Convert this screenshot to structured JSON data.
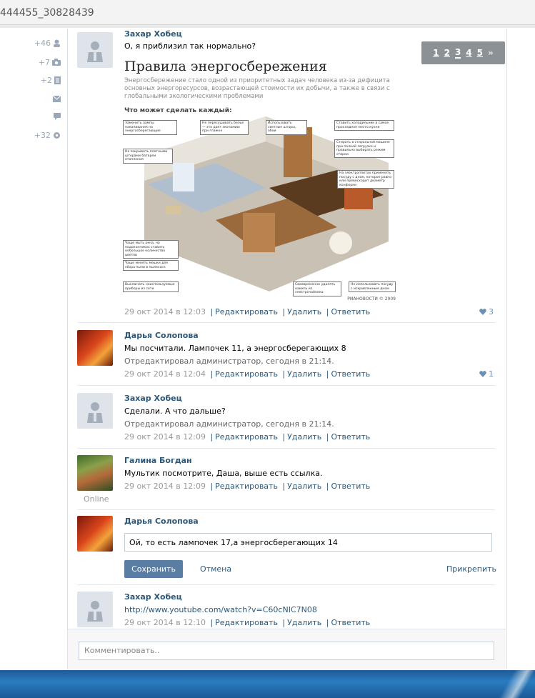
{
  "window": {
    "title": "444455_30828439"
  },
  "left_nav": [
    {
      "count": "+46",
      "icon": "user-icon"
    },
    {
      "count": "+7",
      "icon": "camera-icon"
    },
    {
      "count": "+2",
      "icon": "video-icon"
    },
    {
      "count": "",
      "icon": "mail-icon"
    },
    {
      "count": "",
      "icon": "chat-icon"
    },
    {
      "count": "+32",
      "icon": "gear-icon"
    }
  ],
  "pager": {
    "pages": [
      "1",
      "2",
      "3",
      "4",
      "5"
    ],
    "current": "3",
    "next": "»"
  },
  "infographic": {
    "title": "Правила энергосбережения",
    "subtitle": "Энергосбережение стало одной из приоритетных задач человека из-за дефицита основных энергоресурсов, возрастающей стоимости их добычи, а также в связи с глобальными экологическими проблемами",
    "what_label": "Что может сделать каждый:",
    "credit": "РИАНОВОСТИ © 2009"
  },
  "comments": [
    {
      "author": "Захар Хобец",
      "text": "О, я приблизил так нормально?",
      "date": "29 окт 2014 в 12:03",
      "actions": [
        "Редактировать",
        "Удалить",
        "Ответить"
      ],
      "likes": "3"
    },
    {
      "author": "Дарья Солопова",
      "text": "Мы посчитали. Лампочек 11, а энергосберегающих 8",
      "edited": "Отредактировал администратор, сегодня в 21:14.",
      "date": "29 окт 2014 в 12:04",
      "actions": [
        "Редактировать",
        "Удалить",
        "Ответить"
      ],
      "likes": "1"
    },
    {
      "author": "Захар Хобец",
      "text": "Сделали. А что дальше?",
      "edited": "Отредактировал администратор, сегодня в 21:14.",
      "date": "29 окт 2014 в 12:09",
      "actions": [
        "Редактировать",
        "Удалить",
        "Ответить"
      ]
    },
    {
      "author": "Галина Богдан",
      "text": "Мультик посмотрите, Даша, выше есть ссылка.",
      "date": "29 окт 2014 в 12:09",
      "actions": [
        "Редактировать",
        "Удалить",
        "Ответить"
      ],
      "status": "Online"
    },
    {
      "author": "Захар Хобец",
      "text": "http://www.youtube.com/watch?v=C60cNIC7N08",
      "date": "29 окт 2014 в 12:10",
      "actions": [
        "Редактировать",
        "Удалить",
        "Ответить"
      ]
    }
  ],
  "edit_form": {
    "author": "Дарья Солопова",
    "value": "Ой, то есть лампочек 17,а энергосберегающих 14",
    "save": "Сохранить",
    "cancel": "Отмена",
    "attach": "Прикрепить"
  },
  "comment_input": {
    "placeholder": "Комментировать.."
  },
  "colors": {
    "link": "#2b587a",
    "button": "#597da3",
    "like": "#6d8fb3"
  }
}
